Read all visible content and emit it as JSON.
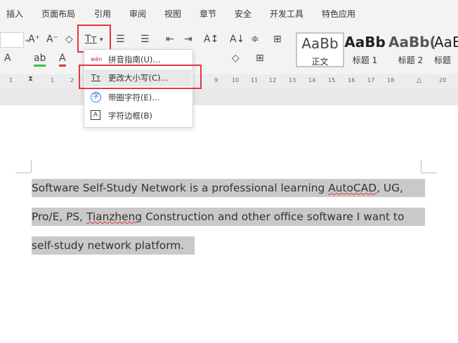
{
  "menubar": {
    "tabs": [
      "插入",
      "页面布局",
      "引用",
      "审阅",
      "视图",
      "章节",
      "安全",
      "开发工具",
      "特色应用"
    ]
  },
  "toolbar": {
    "grow_font": "A⁺",
    "shrink_font": "A⁻",
    "clear_format": "◇",
    "change_case": "Tт",
    "bullets": "☰",
    "numbering": "☰",
    "outdent": "⇤",
    "indent": "⇥",
    "sort": "A↓",
    "line_spacing": "≑",
    "table_border": "⊞",
    "text_effect": "A",
    "highlight": "ab",
    "font_color": "A",
    "shading": "◇",
    "borders": "⊞"
  },
  "styles": [
    {
      "sample": "AaBb",
      "label": "正文"
    },
    {
      "sample": "AaBb",
      "label": "标题 1"
    },
    {
      "sample": "AaBb(",
      "label": "标题 2"
    },
    {
      "sample": "AaBl",
      "label": "标题"
    }
  ],
  "ruler": {
    "ticks": [
      "1",
      "1",
      "2",
      "4",
      "6",
      "8",
      "9",
      "10",
      "11",
      "12",
      "13",
      "14",
      "15",
      "16",
      "17",
      "18",
      "20"
    ]
  },
  "dropdown": {
    "items": [
      {
        "icon": "wén",
        "label": "拼音指南(U)..."
      },
      {
        "icon": "Tт",
        "label": "更改大小写(C)..."
      },
      {
        "icon": "字",
        "label": "带圈字符(E)..."
      },
      {
        "icon": "A",
        "label": "字符边框(B)"
      }
    ]
  },
  "document": {
    "line1": [
      "Software Self-Study Network is a professional learning ",
      "AutoCAD",
      ", UG,"
    ],
    "line2": [
      "Pro/E, PS, ",
      "Tianzheng",
      " Construction and other office software I want to"
    ],
    "line3": "self-study network platform."
  },
  "colors": {
    "highlight_box": "#e0393e",
    "selection": "#c9c9c9",
    "ribbon_bg": "#f3f3f3"
  }
}
